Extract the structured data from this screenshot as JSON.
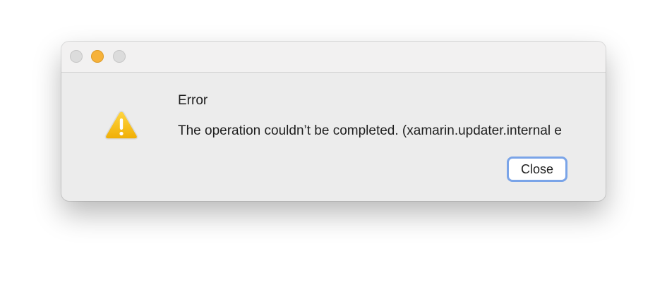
{
  "dialog": {
    "title": "Error",
    "message": "The operation couldn’t be completed. (xamarin.updater.internal e",
    "close_label": "Close",
    "icon": "warning-icon"
  },
  "colors": {
    "minimize_button": "#f6b23a",
    "focus_ring": "#7aa4e8",
    "warning_fill": "#f4c20d"
  }
}
